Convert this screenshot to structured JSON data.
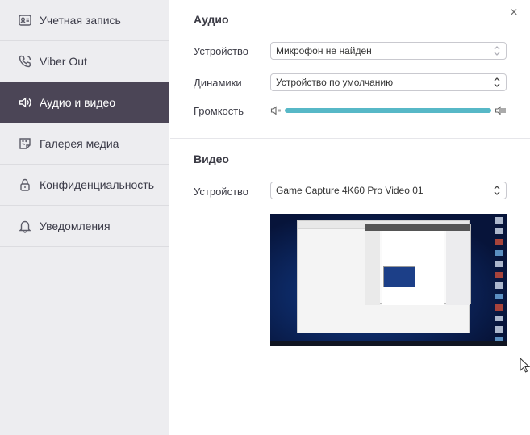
{
  "sidebar": {
    "items": [
      {
        "label": "Учетная запись",
        "icon": "account-card-icon"
      },
      {
        "label": "Viber Out",
        "icon": "phone-icon"
      },
      {
        "label": "Аудио и видео",
        "icon": "speaker-icon",
        "active": true
      },
      {
        "label": "Галерея медиа",
        "icon": "sticker-icon"
      },
      {
        "label": "Конфиденциальность",
        "icon": "lock-icon"
      },
      {
        "label": "Уведомления",
        "icon": "bell-icon"
      }
    ]
  },
  "audio": {
    "title": "Аудио",
    "device_label": "Устройство",
    "device_value": "Микрофон не найден",
    "speakers_label": "Динамики",
    "speakers_value": "Устройство по умолчанию",
    "volume_label": "Громкость",
    "volume_level": 1.0
  },
  "video": {
    "title": "Видео",
    "device_label": "Устройство",
    "device_value": "Game Capture 4K60 Pro Video 01"
  },
  "colors": {
    "sidebar_bg": "#ededf0",
    "active_bg": "#4b4556",
    "slider": "#57b8c7"
  },
  "close_label": "×"
}
